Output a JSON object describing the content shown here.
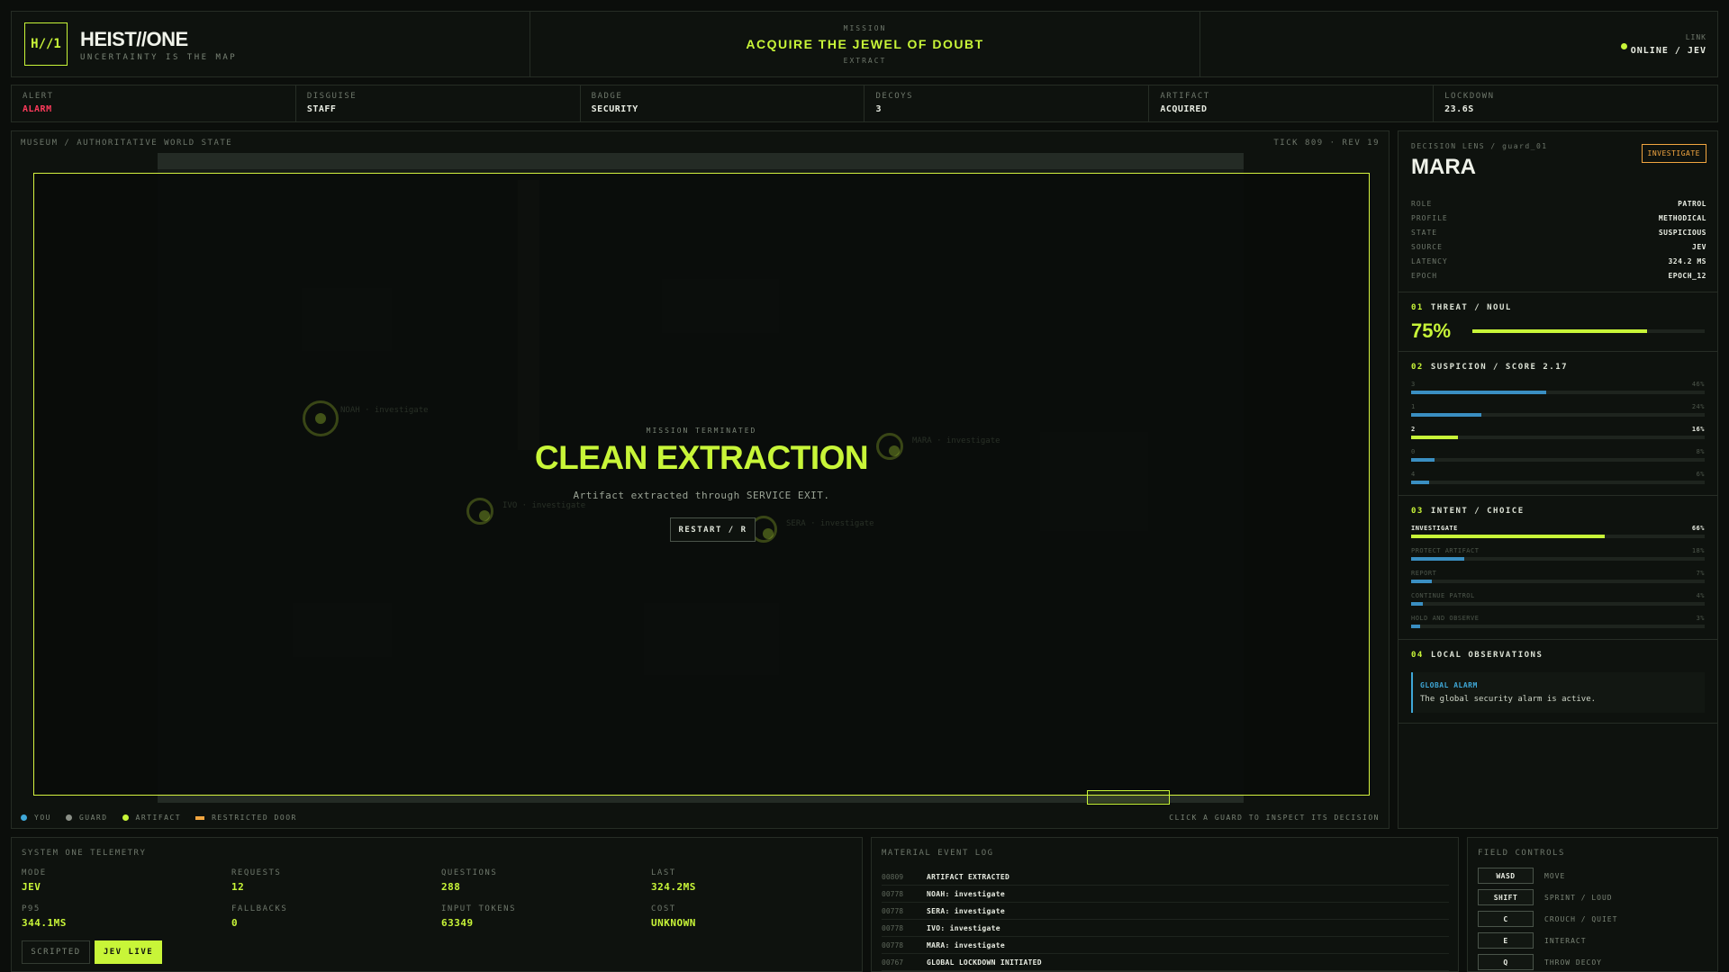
{
  "header": {
    "logo": "H//1",
    "brand": "HEIST//ONE",
    "tagline": "UNCERTAINTY IS THE MAP",
    "mission_label": "MISSION",
    "mission_title": "ACQUIRE THE JEWEL OF DOUBT",
    "mission_sub": "EXTRACT",
    "link_label": "LINK",
    "link_value": "ONLINE / JEV"
  },
  "status": [
    {
      "label": "ALERT",
      "value": "ALARM",
      "color": "#ff3b5c"
    },
    {
      "label": "DISGUISE",
      "value": "STAFF"
    },
    {
      "label": "BADGE",
      "value": "SECURITY"
    },
    {
      "label": "DECOYS",
      "value": "3"
    },
    {
      "label": "ARTIFACT",
      "value": "ACQUIRED"
    },
    {
      "label": "LOCKDOWN",
      "value": "23.6S"
    }
  ],
  "map": {
    "title": "MUSEUM / AUTHORITATIVE WORLD STATE",
    "tick": "TICK 809 · REV 19",
    "overlay": {
      "sub": "MISSION TERMINATED",
      "title": "CLEAN EXTRACTION",
      "message": "Artifact extracted through SERVICE EXIT.",
      "restart": "RESTART / R"
    },
    "legend": [
      {
        "label": "YOU",
        "color": "#3fa8d8",
        "shape": "dot"
      },
      {
        "label": "GUARD",
        "color": "#8a8f86",
        "shape": "dot"
      },
      {
        "label": "ARTIFACT",
        "color": "#c8f538",
        "shape": "dot"
      },
      {
        "label": "RESTRICTED DOOR",
        "color": "#f2a640",
        "shape": "bar"
      }
    ],
    "hint": "CLICK A GUARD TO INSPECT ITS DECISION"
  },
  "lens": {
    "caption": "DECISION LENS / guard_01",
    "name": "MARA",
    "badge": "INVESTIGATE",
    "props": [
      {
        "k": "ROLE",
        "v": "PATROL"
      },
      {
        "k": "PROFILE",
        "v": "METHODICAL"
      },
      {
        "k": "STATE",
        "v": "SUSPICIOUS"
      },
      {
        "k": "SOURCE",
        "v": "JEV"
      },
      {
        "k": "LATENCY",
        "v": "324.2 MS"
      },
      {
        "k": "EPOCH",
        "v": "EPOCH_12"
      }
    ],
    "threat": {
      "num": "01",
      "title": "THREAT / NOUL",
      "value": "75%",
      "fraction": 0.75
    },
    "suspicion": {
      "num": "02",
      "title": "SUSPICION / SCORE 2.17",
      "rows": [
        {
          "label": "3",
          "pct": "46%",
          "value": 0.46,
          "highlight": false
        },
        {
          "label": "1",
          "pct": "24%",
          "value": 0.24,
          "highlight": false
        },
        {
          "label": "2",
          "pct": "16%",
          "value": 0.16,
          "highlight": true
        },
        {
          "label": "0",
          "pct": "8%",
          "value": 0.08,
          "highlight": false
        },
        {
          "label": "4",
          "pct": "6%",
          "value": 0.06,
          "highlight": false
        }
      ]
    },
    "intent": {
      "num": "03",
      "title": "INTENT / CHOICE",
      "rows": [
        {
          "label": "INVESTIGATE",
          "pct": "66%",
          "value": 0.66,
          "highlight": true
        },
        {
          "label": "PROTECT ARTIFACT",
          "pct": "18%",
          "value": 0.18,
          "highlight": false
        },
        {
          "label": "REPORT",
          "pct": "7%",
          "value": 0.07,
          "highlight": false
        },
        {
          "label": "CONTINUE PATROL",
          "pct": "4%",
          "value": 0.04,
          "highlight": false
        },
        {
          "label": "HOLD AND OBSERVE",
          "pct": "3%",
          "value": 0.03,
          "highlight": false
        }
      ]
    },
    "observations": {
      "num": "04",
      "title": "LOCAL OBSERVATIONS",
      "item_title": "GLOBAL ALARM",
      "item_text": "The global security alarm is active."
    }
  },
  "telemetry": {
    "caption": "SYSTEM ONE TELEMETRY",
    "cells": [
      {
        "label": "MODE",
        "value": "JEV"
      },
      {
        "label": "REQUESTS",
        "value": "12"
      },
      {
        "label": "QUESTIONS",
        "value": "288"
      },
      {
        "label": "LAST",
        "value": "324.2MS"
      },
      {
        "label": "P95",
        "value": "344.1MS"
      },
      {
        "label": "FALLBACKS",
        "value": "0"
      },
      {
        "label": "INPUT TOKENS",
        "value": "63349"
      },
      {
        "label": "COST",
        "value": "UNKNOWN"
      }
    ],
    "btn_scripted": "SCRIPTED",
    "btn_live": "JEV LIVE"
  },
  "log": {
    "caption": "MATERIAL EVENT LOG",
    "rows": [
      {
        "t": "00809",
        "m": "ARTIFACT EXTRACTED"
      },
      {
        "t": "00778",
        "m": "NOAH: investigate"
      },
      {
        "t": "00778",
        "m": "SERA: investigate"
      },
      {
        "t": "00778",
        "m": "IVO: investigate"
      },
      {
        "t": "00778",
        "m": "MARA: investigate"
      },
      {
        "t": "00767",
        "m": "GLOBAL LOCKDOWN INITIATED"
      }
    ]
  },
  "controls": {
    "caption": "FIELD CONTROLS",
    "rows": [
      {
        "key": "WASD",
        "action": "MOVE"
      },
      {
        "key": "SHIFT",
        "action": "SPRINT / LOUD"
      },
      {
        "key": "C",
        "action": "CROUCH / QUIET"
      },
      {
        "key": "E",
        "action": "INTERACT"
      },
      {
        "key": "Q",
        "action": "THROW DECOY"
      }
    ]
  }
}
